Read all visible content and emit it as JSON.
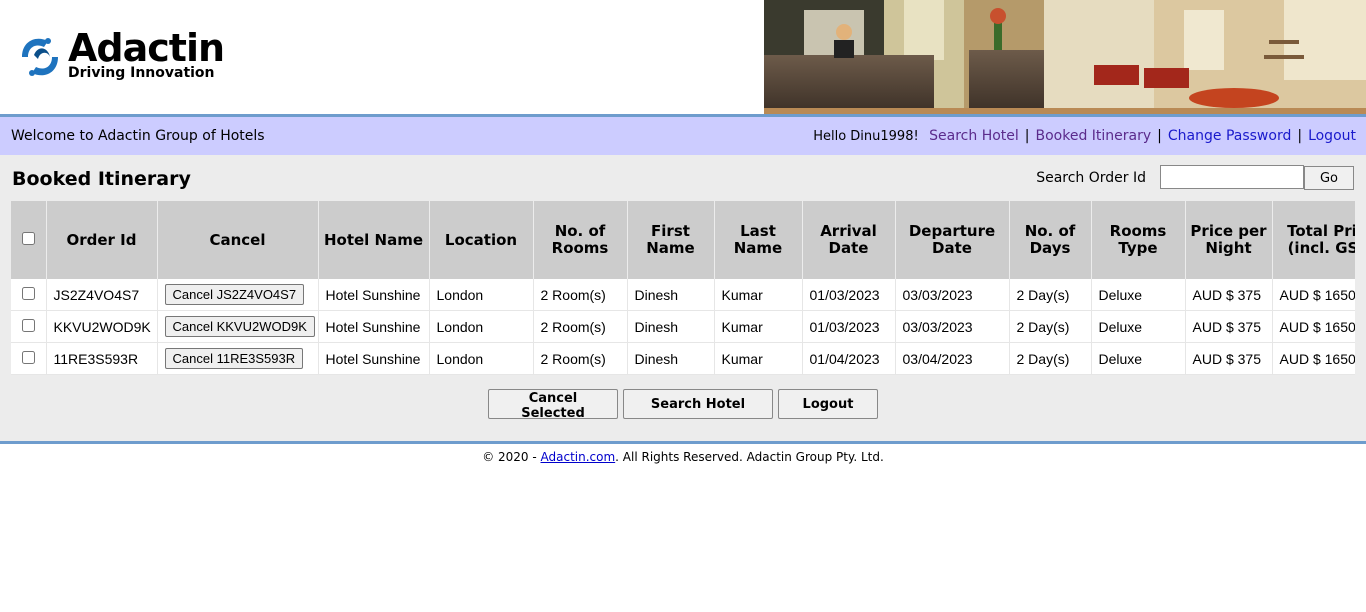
{
  "brand": {
    "name": "Adactin",
    "tagline": "Driving Innovation"
  },
  "welcome_bar": {
    "welcome_text": "Welcome to Adactin Group of Hotels",
    "hello_text": "Hello Dinu1998!",
    "links": {
      "search_hotel": "Search Hotel",
      "booked_itinerary": "Booked Itinerary",
      "change_password": "Change Password",
      "logout": "Logout"
    },
    "separator": "|"
  },
  "main": {
    "page_title": "Booked Itinerary",
    "search_order_label": "Search Order Id",
    "search_order_value": "",
    "go_label": "Go"
  },
  "table": {
    "headers": {
      "order_id": "Order Id",
      "cancel": "Cancel",
      "hotel_name": "Hotel Name",
      "location": "Location",
      "no_of_rooms": "No. of Rooms",
      "first_name": "First Name",
      "last_name": "Last Name",
      "arrival_date": "Arrival Date",
      "departure_date": "Departure Date",
      "no_of_days": "No. of Days",
      "rooms_type": "Rooms Type",
      "price_per_night": "Price per Night",
      "total_price": "Total Price (incl. GST)"
    },
    "rows": [
      {
        "order_id": "JS2Z4VO4S7",
        "cancel_label": "Cancel JS2Z4VO4S7",
        "hotel_name": "Hotel Sunshine",
        "location": "London",
        "rooms": "2 Room(s)",
        "first_name": "Dinesh",
        "last_name": "Kumar",
        "arrival": "01/03/2023",
        "departure": "03/03/2023",
        "days": "2 Day(s)",
        "room_type": "Deluxe",
        "price_per_night": "AUD $ 375",
        "total_price": "AUD $ 1650"
      },
      {
        "order_id": "KKVU2WOD9K",
        "cancel_label": "Cancel KKVU2WOD9K",
        "hotel_name": "Hotel Sunshine",
        "location": "London",
        "rooms": "2 Room(s)",
        "first_name": "Dinesh",
        "last_name": "Kumar",
        "arrival": "01/03/2023",
        "departure": "03/03/2023",
        "days": "2 Day(s)",
        "room_type": "Deluxe",
        "price_per_night": "AUD $ 375",
        "total_price": "AUD $ 1650"
      },
      {
        "order_id": "11RE3S593R",
        "cancel_label": "Cancel 11RE3S593R",
        "hotel_name": "Hotel Sunshine",
        "location": "London",
        "rooms": "2 Room(s)",
        "first_name": "Dinesh",
        "last_name": "Kumar",
        "arrival": "01/04/2023",
        "departure": "03/04/2023",
        "days": "2 Day(s)",
        "room_type": "Deluxe",
        "price_per_night": "AUD $ 375",
        "total_price": "AUD $ 1650"
      }
    ]
  },
  "actions": {
    "cancel_selected": "Cancel Selected",
    "search_hotel": "Search Hotel",
    "logout": "Logout"
  },
  "footer": {
    "prefix": "© 2020 - ",
    "link_text": "Adactin.com",
    "suffix": ". All Rights Reserved. Adactin Group Pty. Ltd."
  },
  "colors": {
    "welcome_bar_bg": "#ccccff",
    "rule": "#6e9ccd",
    "content_bg": "#ececec",
    "header_cell_bg": "#cccccc",
    "logo_blue": "#1e73be"
  },
  "icons": {
    "logo_mark": "adactin-swirl-icon",
    "banner": "hotel-lobby-banner"
  }
}
